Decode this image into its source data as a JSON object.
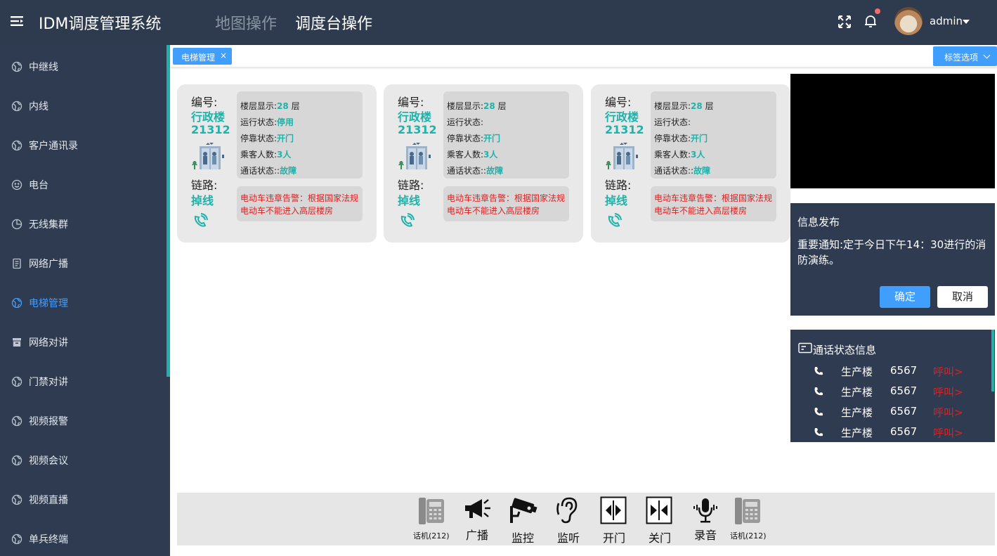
{
  "header": {
    "app_title": "IDM调度管理系统",
    "tabs": [
      {
        "label": "地图操作"
      },
      {
        "label": "调度台操作"
      }
    ],
    "user_name": "admin"
  },
  "sidebar": {
    "items": [
      {
        "label": "中继线",
        "icon": "globe-icon"
      },
      {
        "label": "内线",
        "icon": "globe-icon"
      },
      {
        "label": "客户通讯录",
        "icon": "globe-icon"
      },
      {
        "label": "电台",
        "icon": "smile-icon"
      },
      {
        "label": "无线集群",
        "icon": "pie-icon"
      },
      {
        "label": "网络广播",
        "icon": "document-icon"
      },
      {
        "label": "电梯管理",
        "icon": "globe-icon",
        "active": true
      },
      {
        "label": "网络对讲",
        "icon": "archive-icon"
      },
      {
        "label": "门禁对讲",
        "icon": "globe-icon"
      },
      {
        "label": "视频报警",
        "icon": "globe-icon"
      },
      {
        "label": "视频会议",
        "icon": "globe-icon"
      },
      {
        "label": "视频直播",
        "icon": "globe-icon"
      },
      {
        "label": "单兵终端",
        "icon": "globe-icon"
      }
    ]
  },
  "tabs_bar": {
    "open_tab": "电梯管理",
    "close_glyph": "×",
    "options_label": "标签选项"
  },
  "cards": [
    {
      "id_label": "编号:",
      "building": "行政楼",
      "number": "21312",
      "link_label": "链路:",
      "link_status": "掉线",
      "floor_label": "楼层显示:",
      "floor_value": "28",
      "floor_unit": " 层",
      "run_label": "运行状态:",
      "run_value": "停用",
      "stop_label": "停靠状态:",
      "stop_value": "开门",
      "pass_label": "乘客人数:",
      "pass_value": "3人",
      "call_label": "通话状态::",
      "call_value": "故障",
      "alarm": "电动车违章告警：根据国家法规电动车不能进入高层楼房"
    },
    {
      "id_label": "编号:",
      "building": "行政楼",
      "number": "21312",
      "link_label": "链路:",
      "link_status": "掉线",
      "floor_label": "楼层显示:",
      "floor_value": "28",
      "floor_unit": " 层",
      "run_label": "运行状态:",
      "run_value": "",
      "stop_label": "停靠状态:",
      "stop_value": "开门",
      "pass_label": "乘客人数:",
      "pass_value": "3人",
      "call_label": "通话状态::",
      "call_value": "故障",
      "alarm": "电动车违章告警：根据国家法规电动车不能进入高层楼房"
    },
    {
      "id_label": "编号:",
      "building": "行政楼",
      "number": "21312",
      "link_label": "链路:",
      "link_status": "掉线",
      "floor_label": "楼层显示:",
      "floor_value": "28",
      "floor_unit": " 层",
      "run_label": "运行状态:",
      "run_value": "",
      "stop_label": "停靠状态:",
      "stop_value": "开门",
      "pass_label": "乘客人数:",
      "pass_value": "3人",
      "call_label": "通话状态::",
      "call_value": "故障",
      "alarm": "电动车违章告警：根据国家法规电动车不能进入高层楼房"
    }
  ],
  "notice": {
    "title": "信息发布",
    "body": "重要通知:定于今日下午14：30进行的消防演练。",
    "ok_label": "确定",
    "cancel_label": "取消"
  },
  "calls": {
    "title": "通话状态信息",
    "rows": [
      {
        "building": "生产楼",
        "number": "6567",
        "status": "呼叫>"
      },
      {
        "building": "生产楼",
        "number": "6567",
        "status": "呼叫>"
      },
      {
        "building": "生产楼",
        "number": "6567",
        "status": "呼叫>"
      },
      {
        "building": "生产楼",
        "number": "6567",
        "status": "呼叫>"
      }
    ]
  },
  "toolbar": {
    "items": [
      {
        "label": "话机(212)",
        "icon": "desk-phone-icon"
      },
      {
        "label": "广播",
        "icon": "megaphone-icon"
      },
      {
        "label": "监控",
        "icon": "cctv-camera-icon"
      },
      {
        "label": "监听",
        "icon": "ear-icon"
      },
      {
        "label": "开门",
        "icon": "door-open-icon"
      },
      {
        "label": "关门",
        "icon": "door-close-icon"
      },
      {
        "label": "录音",
        "icon": "microphone-icon"
      },
      {
        "label": "话机(212)",
        "icon": "desk-phone-icon"
      }
    ]
  },
  "colors": {
    "nav_bg": "#2e3a4d",
    "accent_blue": "#409eff",
    "accent_teal": "#20b2aa",
    "alarm_red": "#e02020"
  }
}
